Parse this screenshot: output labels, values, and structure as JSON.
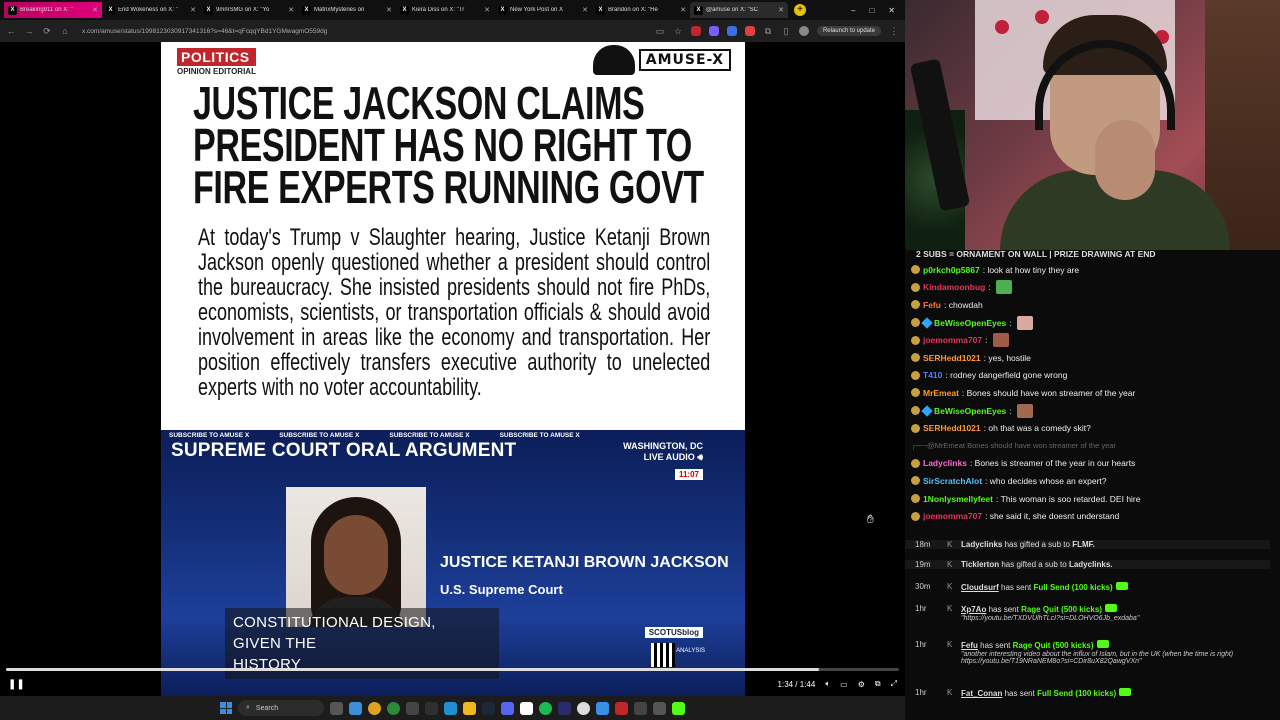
{
  "browser": {
    "tabs": [
      {
        "label": "Breaking911 on X: \"",
        "active": false
      },
      {
        "label": "End Wokeness on X: \"",
        "active": false
      },
      {
        "label": "9mmSMG on X: \"Yo",
        "active": false
      },
      {
        "label": "MatrixMysteries on",
        "active": false
      },
      {
        "label": "Kiera Diss on X: \"Tr",
        "active": false
      },
      {
        "label": "New York Post on X",
        "active": false
      },
      {
        "label": "Brandon on X: \"He",
        "active": false
      },
      {
        "label": "@amuse on X: \"SC",
        "active": true
      }
    ],
    "url": "x.com/amuse/status/1998123030917341316?s=46&t=qFcqqYBd1YGMwagmO559dg",
    "relaunch_label": "Relaunch to update",
    "window_controls": [
      "–",
      "□",
      "✕"
    ]
  },
  "article": {
    "category": "POLITICS",
    "subcategory": "OPINION EDITORIAL",
    "brand": "AMUSE-X",
    "headline_lines": [
      "JUSTICE JACKSON CLAIMS",
      "PRESIDENT HAS NO RIGHT TO",
      "FIRE EXPERTS RUNNING GOVT"
    ],
    "body": "At today's Trump v Slaughter hearing, Justice Ketanji Brown Jackson openly questioned whether a president should control the bureaucracy. She insisted presidents should not fire PhDs, economists, scientists, or transportation officials & should avoid involvement in areas like the economy and transportation. Her position effectively transfers executive authority to unelected experts with no voter accountability."
  },
  "broadcast": {
    "subscribe_label": "SUBSCRIBE TO AMUSE X",
    "title": "SUPREME COURT ORAL ARGUMENT",
    "location": "WASHINGTON, DC",
    "live_audio": "LIVE AUDIO",
    "time": "11:07",
    "justice_name": "JUSTICE KETANJI BROWN JACKSON",
    "justice_title": "U.S. Supreme Court",
    "caption_lines": [
      "CONSTITUTIONAL DESIGN,",
      "GIVEN THE",
      "HISTORY"
    ],
    "scotus": "SCOTUSblog",
    "analysis": "ANALYSIS"
  },
  "player": {
    "time_display": "1:34 / 1:44",
    "progress": 0.91
  },
  "taskbar": {
    "search_label": "Search"
  },
  "stream": {
    "banner": "2 SUBS = ORNAMENT ON WALL | PRIZE DRAWING AT END"
  },
  "chat": {
    "messages": [
      {
        "user": "p0rkch0p5867",
        "color": "#53fc18",
        "text": "look at how tiny they are",
        "emote": null
      },
      {
        "user": "Kindamoonbug",
        "color": "#e8345a",
        "text": "",
        "emote": "#4caf50"
      },
      {
        "user": "Fefu",
        "color": "#ff7a2a",
        "text": "chowdah",
        "emote": null
      },
      {
        "user": "BeWiseOpenEyes",
        "color": "#53fc18",
        "text": "",
        "emote": "#d9a8a0"
      },
      {
        "user": "joemomma707",
        "color": "#e8345a",
        "text": "",
        "emote": "#a05a48"
      },
      {
        "user": "SERHedd1021",
        "color": "#ff9a2a",
        "text": "yes, hostile",
        "emote": null
      },
      {
        "user": "T410",
        "color": "#4f7cff",
        "text": "rodney dangerfield gone wrong",
        "emote": null
      },
      {
        "user": "MrEmeat",
        "color": "#ff9a2a",
        "text": "Bones should have won streamer of the year",
        "emote": null
      },
      {
        "user": "BeWiseOpenEyes",
        "color": "#53fc18",
        "text": "",
        "emote": "#a06a50"
      },
      {
        "user": "SERHedd1021",
        "color": "#ff9a2a",
        "text": "oh that was a comedy skit?",
        "emote": null
      },
      {
        "user": "@MrEmeat",
        "color": "#666666",
        "text": "Bones should have won streamer of the year",
        "emote": null
      },
      {
        "user": "Ladyclinks",
        "color": "#ff6ad5",
        "text": "Bones is streamer of the year in our hearts",
        "emote": null
      },
      {
        "user": "SirScratchAlot",
        "color": "#4fc3ff",
        "text": "who decides whose an expert?",
        "emote": null
      },
      {
        "user": "1Nonlysmellyfeet",
        "color": "#53fc18",
        "text": "This woman is soo retarded. DEI hire",
        "emote": null
      },
      {
        "user": "joemomma707",
        "color": "#e8345a",
        "text": "she said it, she doesnt understand",
        "emote": null
      }
    ],
    "events": [
      {
        "time": "18m",
        "user": "Ladyclinks",
        "action": "has gifted a sub to",
        "target": "FLMF.",
        "reward": "",
        "quote": ""
      },
      {
        "time": "19m",
        "user": "Ticklerton",
        "action": "has gifted a sub to",
        "target": "Ladyclinks.",
        "reward": "",
        "quote": ""
      },
      {
        "time": "30m",
        "user": "Cloudsurf",
        "action": "has sent",
        "target": "",
        "reward": "Full Send (100 kicks)",
        "quote": ""
      },
      {
        "time": "1hr",
        "user": "Xp7Ao",
        "action": "has sent",
        "target": "",
        "reward": "Rage Quit (500 kicks)",
        "quote": "\"https://youtu.be/TXDVUlhTLcI?si=DLOHVO6Jb_exdaba\""
      },
      {
        "time": "1hr",
        "user": "Fefu",
        "action": "has sent",
        "target": "",
        "reward": "Rage Quit (500 kicks)",
        "quote": "\"another interesting video about the influx of Islam, but in the UK (when the time is right) https://youtu.be/T19NRaNEM8o?si=CDir8uX82QawgVXn\""
      },
      {
        "time": "1hr",
        "user": "Fat_Conan",
        "action": "has sent",
        "target": "",
        "reward": "Full Send (100 kicks)",
        "quote": ""
      }
    ]
  }
}
